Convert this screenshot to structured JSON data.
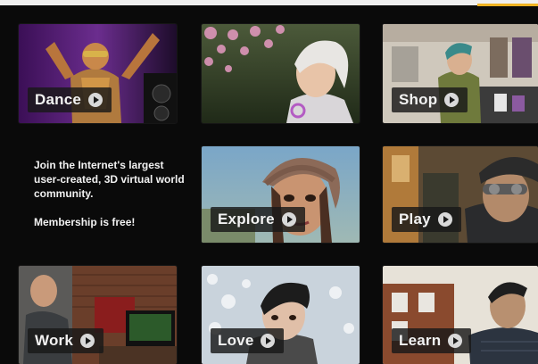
{
  "tiles": [
    {
      "id": "dance",
      "label": "Dance"
    },
    {
      "id": "shop",
      "label": "Shop"
    },
    {
      "id": "explore",
      "label": "Explore"
    },
    {
      "id": "play",
      "label": "Play"
    },
    {
      "id": "work",
      "label": "Work"
    },
    {
      "id": "love",
      "label": "Love"
    },
    {
      "id": "learn",
      "label": "Learn"
    }
  ],
  "promo": {
    "headline": "Join the Internet's largest user-created, 3D virtual world community.",
    "subline": "Membership is free!"
  },
  "colors": {
    "background": "#0a0a0a",
    "label_bg": "#191919",
    "label_text": "#f2f2f2",
    "accent": "#f0b323"
  },
  "icons": {
    "tile_button": "play-circle-icon"
  }
}
